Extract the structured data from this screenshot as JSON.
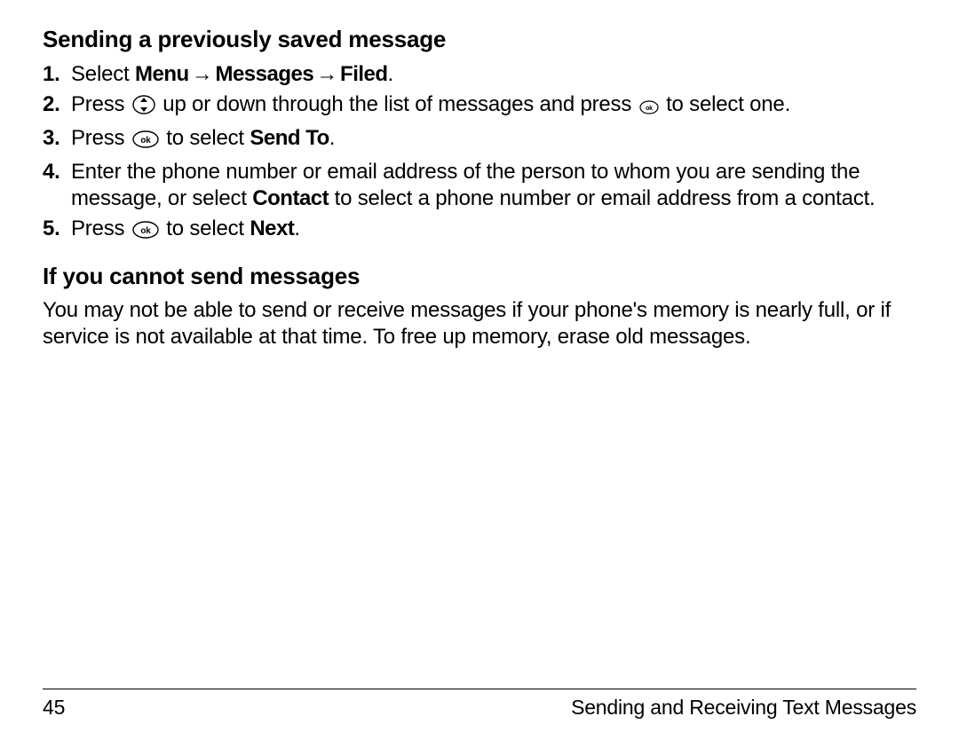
{
  "section1": {
    "heading": "Sending a previously saved message",
    "steps": [
      {
        "num": "1.",
        "pre": "Select ",
        "path": [
          "Menu",
          "Messages",
          "Filed"
        ],
        "post": "."
      },
      {
        "num": "2.",
        "t1": "Press ",
        "t2": " up or down through the list of messages and press ",
        "t3": " to select one."
      },
      {
        "num": "3.",
        "t1": "Press ",
        "t2": " to select ",
        "bold": "Send To",
        "t3": "."
      },
      {
        "num": "4.",
        "t1": "Enter the phone number or email address of the person to whom you are sending the message, or select ",
        "bold": "Contact",
        "t2": " to select a phone number or email address from a contact."
      },
      {
        "num": "5.",
        "t1": "Press ",
        "t2": " to select ",
        "bold": "Next",
        "t3": "."
      }
    ]
  },
  "section2": {
    "heading": "If you cannot send messages",
    "body": "You may not be able to send or receive messages if your phone's memory is nearly full, or if service is not available at that time. To free up memory, erase old messages."
  },
  "footer": {
    "page": "45",
    "chapter": "Sending and Receiving Text Messages"
  },
  "glyphs": {
    "arrow": "→"
  }
}
